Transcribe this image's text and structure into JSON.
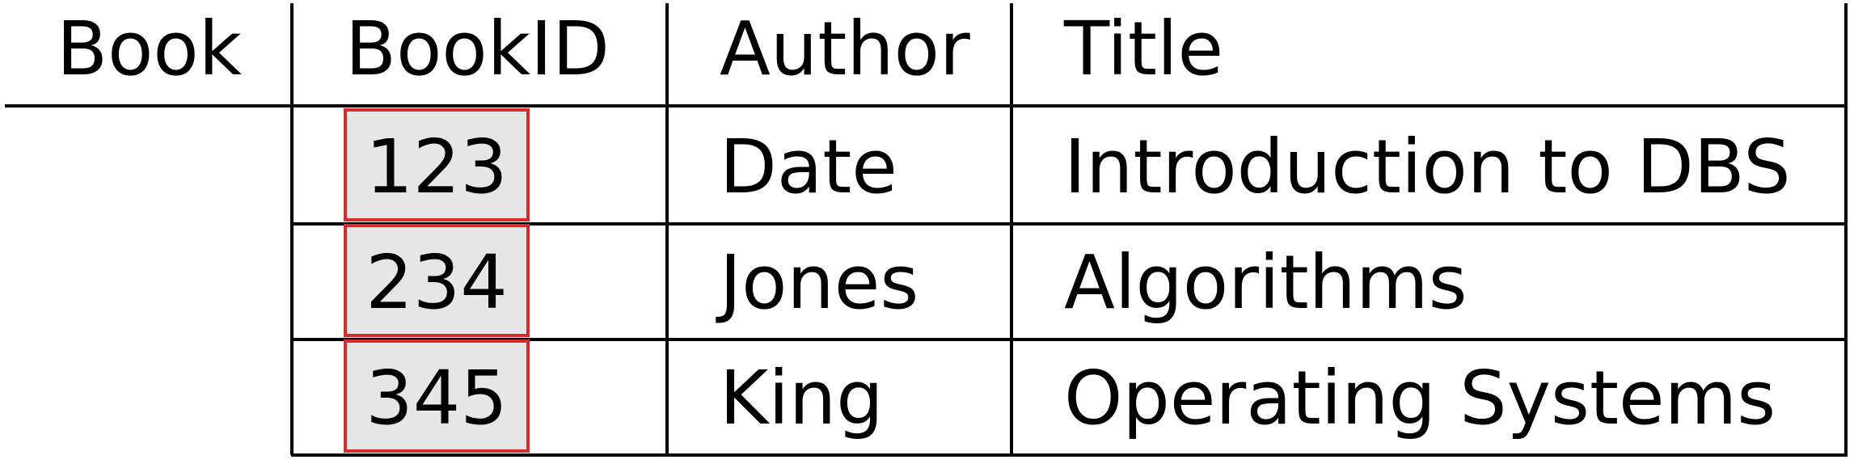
{
  "relation": {
    "name": "Book",
    "columns": [
      "BookID",
      "Author",
      "Title"
    ],
    "rows": [
      [
        "123",
        "Date",
        "Introduction to DBS"
      ],
      [
        "234",
        "Jones",
        "Algorithms"
      ],
      [
        "345",
        "King",
        "Operating Systems"
      ]
    ]
  },
  "style": {
    "key_highlight_fill": "#e6e6e6",
    "key_highlight_border": "#d62b2b",
    "line_color": "#000000",
    "background": "#ffffff"
  }
}
